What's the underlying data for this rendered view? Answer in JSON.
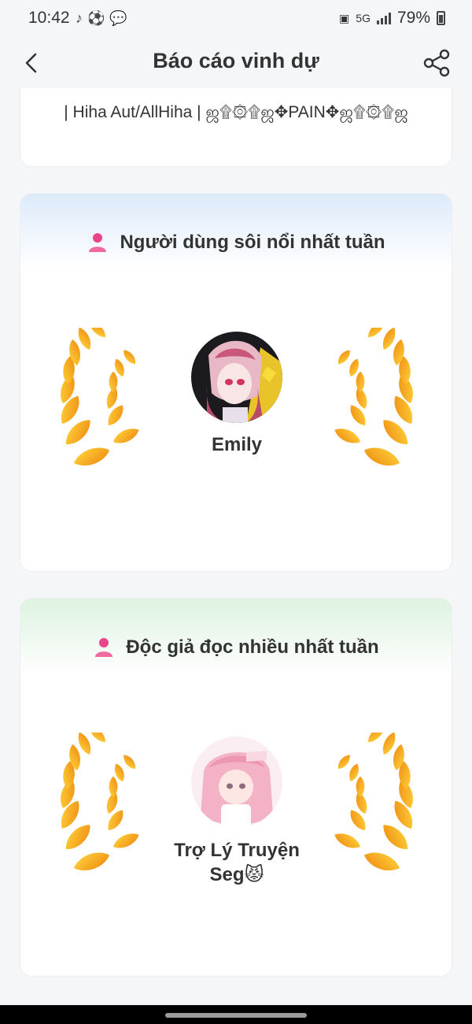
{
  "status_bar": {
    "time": "10:42",
    "network": "5G",
    "battery": "79%"
  },
  "header": {
    "title": "Báo cáo vinh dự"
  },
  "top_card": {
    "signature": "| Hiha Aut/AllHiha | ஜ۩۞۩ஜ✥PAIN✥ஜ۩۞۩ஜ"
  },
  "sections": [
    {
      "title": "Người dùng sôi nổi nhất tuần",
      "winner_name": "Emily"
    },
    {
      "title": "Độc giả đọc nhiều nhất tuần",
      "winner_name_line1": "Trợ Lý Truyện",
      "winner_name_line2": "Seg😾"
    }
  ],
  "colors": {
    "users_header_tint": "#dceaf9",
    "readers_header_tint": "#ddf3e0",
    "person_icon": "#e8458b",
    "laurel_gold": "#f6b21c",
    "laurel_orange": "#ef8c12"
  },
  "icons": [
    "back-arrow-icon",
    "share-icon",
    "person-icon",
    "laurel-icon"
  ]
}
